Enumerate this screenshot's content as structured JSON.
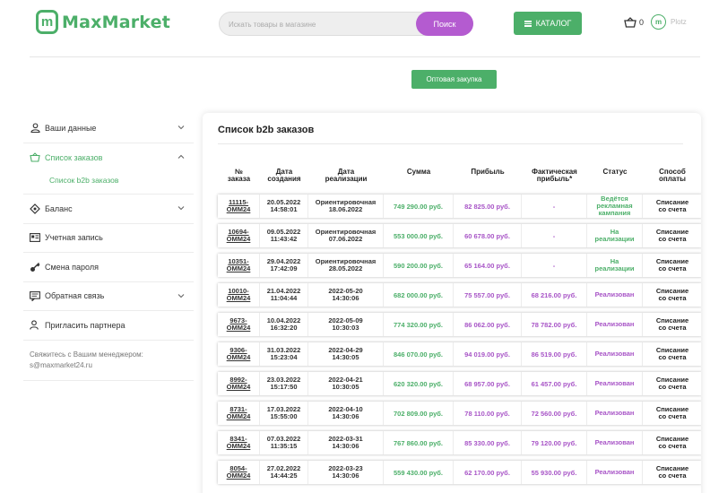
{
  "header": {
    "logo_text": "MaxMarket",
    "search_placeholder": "Искать товары в магазине",
    "search_button": "Поиск",
    "catalog_button": "КАТАЛОГ",
    "cart_count": "0",
    "user_name": "Plotz"
  },
  "wholesale_button": "Оптовая закупка",
  "sidebar": {
    "items": [
      {
        "label": "Ваши данные",
        "icon": "user-icon",
        "chevron": "down"
      },
      {
        "label": "Список заказов",
        "icon": "cart-icon",
        "chevron": "up",
        "active": true
      },
      {
        "label": "Баланс",
        "icon": "diamond-icon",
        "chevron": "down"
      },
      {
        "label": "Учетная запись",
        "icon": "id-card-icon",
        "chevron": ""
      },
      {
        "label": "Смена пароля",
        "icon": "key-icon",
        "chevron": ""
      },
      {
        "label": "Обратная связь",
        "icon": "chat-icon",
        "chevron": "down"
      },
      {
        "label": "Пригласить партнера",
        "icon": "user-add-icon",
        "chevron": ""
      }
    ],
    "sub_item": "Список b2b заказов",
    "contact_text": "Свяжитесь с Вашим менеджером:",
    "contact_email": "s@maxmarket24.ru"
  },
  "table": {
    "title": "Список b2b заказов",
    "headers": {
      "num": [
        "№",
        "заказа"
      ],
      "created": [
        "Дата",
        "создания"
      ],
      "realization": [
        "Дата",
        "реализации"
      ],
      "sum": [
        "Сумма"
      ],
      "profit": [
        "Прибыль"
      ],
      "fact": [
        "Фактическая",
        "прибыль*"
      ],
      "status": [
        "Статус"
      ],
      "pay": [
        "Способ",
        "оплаты"
      ]
    },
    "rows": [
      {
        "num1": "11115-",
        "num2": "OMM24",
        "d1": "20.05.2022",
        "d2": "14:58:01",
        "r1": "Ориентировочная",
        "r2": "18.06.2022",
        "sum": "749 290.00 руб.",
        "profit": "82 825.00 руб.",
        "fact": "-",
        "status": [
          "Ведётся",
          "рекламная",
          "кампания"
        ],
        "status_color": "green",
        "pay1": "Списание",
        "pay2": "со счета"
      },
      {
        "num1": "10694-",
        "num2": "OMM24",
        "d1": "09.05.2022",
        "d2": "11:43:42",
        "r1": "Ориентировочная",
        "r2": "07.06.2022",
        "sum": "553 000.00 руб.",
        "profit": "60 678.00 руб.",
        "fact": "-",
        "status": [
          "На",
          "реализации"
        ],
        "status_color": "green",
        "pay1": "Списание",
        "pay2": "со счета"
      },
      {
        "num1": "10351-",
        "num2": "OMM24",
        "d1": "29.04.2022",
        "d2": "17:42:09",
        "r1": "Ориентировочная",
        "r2": "28.05.2022",
        "sum": "590 200.00 руб.",
        "profit": "65 164.00 руб.",
        "fact": "-",
        "status": [
          "На",
          "реализации"
        ],
        "status_color": "green",
        "pay1": "Списание",
        "pay2": "со счета"
      },
      {
        "num1": "10010-",
        "num2": "OMM24",
        "d1": "21.04.2022",
        "d2": "11:04:44",
        "r1": "2022-05-20",
        "r2": "14:30:06",
        "sum": "682 000.00 руб.",
        "profit": "75 557.00 руб.",
        "fact": "68 216.00 руб.",
        "status": [
          "Реализован"
        ],
        "status_color": "purple",
        "pay1": "Списание",
        "pay2": "со счета"
      },
      {
        "num1": "9673-",
        "num2": "OMM24",
        "d1": "10.04.2022",
        "d2": "16:32:20",
        "r1": "2022-05-09",
        "r2": "10:30:03",
        "sum": "774 320.00 руб.",
        "profit": "86 062.00 руб.",
        "fact": "78 782.00 руб.",
        "status": [
          "Реализован"
        ],
        "status_color": "purple",
        "pay1": "Списание",
        "pay2": "со счета"
      },
      {
        "num1": "9306-",
        "num2": "OMM24",
        "d1": "31.03.2022",
        "d2": "15:23:04",
        "r1": "2022-04-29",
        "r2": "14:30:05",
        "sum": "846 070.00 руб.",
        "profit": "94 019.00 руб.",
        "fact": "86 519.00 руб.",
        "status": [
          "Реализован"
        ],
        "status_color": "purple",
        "pay1": "Списание",
        "pay2": "со счета"
      },
      {
        "num1": "8992-",
        "num2": "OMM24",
        "d1": "23.03.2022",
        "d2": "15:17:50",
        "r1": "2022-04-21",
        "r2": "10:30:05",
        "sum": "620 320.00 руб.",
        "profit": "68 957.00 руб.",
        "fact": "61 457.00 руб.",
        "status": [
          "Реализован"
        ],
        "status_color": "purple",
        "pay1": "Списание",
        "pay2": "со счета"
      },
      {
        "num1": "8731-",
        "num2": "OMM24",
        "d1": "17.03.2022",
        "d2": "15:55:00",
        "r1": "2022-04-10",
        "r2": "14:30:06",
        "sum": "702 809.00 руб.",
        "profit": "78 110.00 руб.",
        "fact": "72 560.00 руб.",
        "status": [
          "Реализован"
        ],
        "status_color": "purple",
        "pay1": "Списание",
        "pay2": "со счета"
      },
      {
        "num1": "8341-",
        "num2": "OMM24",
        "d1": "07.03.2022",
        "d2": "11:35:15",
        "r1": "2022-03-31",
        "r2": "14:30:06",
        "sum": "767 860.00 руб.",
        "profit": "85 330.00 руб.",
        "fact": "79 120.00 руб.",
        "status": [
          "Реализован"
        ],
        "status_color": "purple",
        "pay1": "Списание",
        "pay2": "со счета"
      },
      {
        "num1": "8054-",
        "num2": "OMM24",
        "d1": "27.02.2022",
        "d2": "14:44:25",
        "r1": "2022-03-23",
        "r2": "14:30:06",
        "sum": "559 430.00 руб.",
        "profit": "62 170.00 руб.",
        "fact": "55 930.00 руб.",
        "status": [
          "Реализован"
        ],
        "status_color": "purple",
        "pay1": "Списание",
        "pay2": "со счета"
      }
    ]
  },
  "colors": {
    "green": "#4caf69",
    "purple": "#a855c7",
    "search_button": "#b45bd0"
  }
}
